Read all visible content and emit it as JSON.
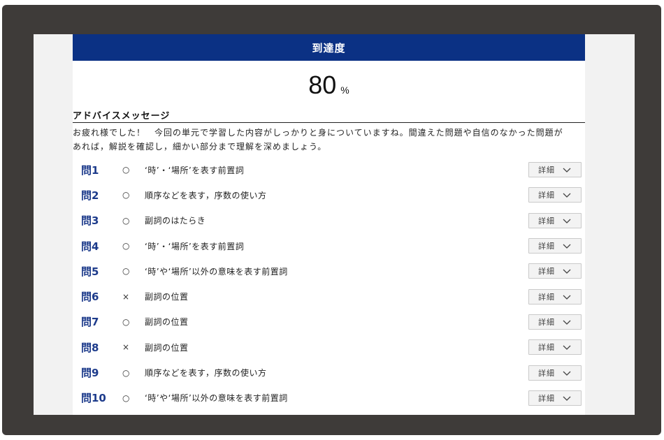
{
  "header": {
    "title": "到達度"
  },
  "score": {
    "value": "80",
    "unit": "%"
  },
  "advice": {
    "heading": "アドバイスメッセージ",
    "line1": "お疲れ様でした！　今回の単元で学習した内容がしっかりと身についていますね。間違えた問題や自信のなかった問題が",
    "line2": "あれば，解説を確認し，細かい部分まで理解を深めましょう。"
  },
  "questions": [
    {
      "label": "問1",
      "mark": "○",
      "topic": "‘時’・‘場所’を表す前置詞",
      "button": "詳細"
    },
    {
      "label": "問2",
      "mark": "○",
      "topic": "順序などを表す，序数の使い方",
      "button": "詳細"
    },
    {
      "label": "問3",
      "mark": "○",
      "topic": "副詞のはたらき",
      "button": "詳細"
    },
    {
      "label": "問4",
      "mark": "○",
      "topic": "‘時’・‘場所’を表す前置詞",
      "button": "詳細"
    },
    {
      "label": "問5",
      "mark": "○",
      "topic": "‘時’や‘場所’以外の意味を表す前置詞",
      "button": "詳細"
    },
    {
      "label": "問6",
      "mark": "×",
      "topic": "副詞の位置",
      "button": "詳細"
    },
    {
      "label": "問7",
      "mark": "○",
      "topic": "副詞の位置",
      "button": "詳細"
    },
    {
      "label": "問8",
      "mark": "×",
      "topic": "副詞の位置",
      "button": "詳細"
    },
    {
      "label": "問9",
      "mark": "○",
      "topic": "順序などを表す，序数の使い方",
      "button": "詳細"
    },
    {
      "label": "問10",
      "mark": "○",
      "topic": "‘時’や‘場所’以外の意味を表す前置詞",
      "button": "詳細"
    }
  ],
  "colors": {
    "title_bar": "#0b3184",
    "question_label": "#1d3b8b"
  }
}
